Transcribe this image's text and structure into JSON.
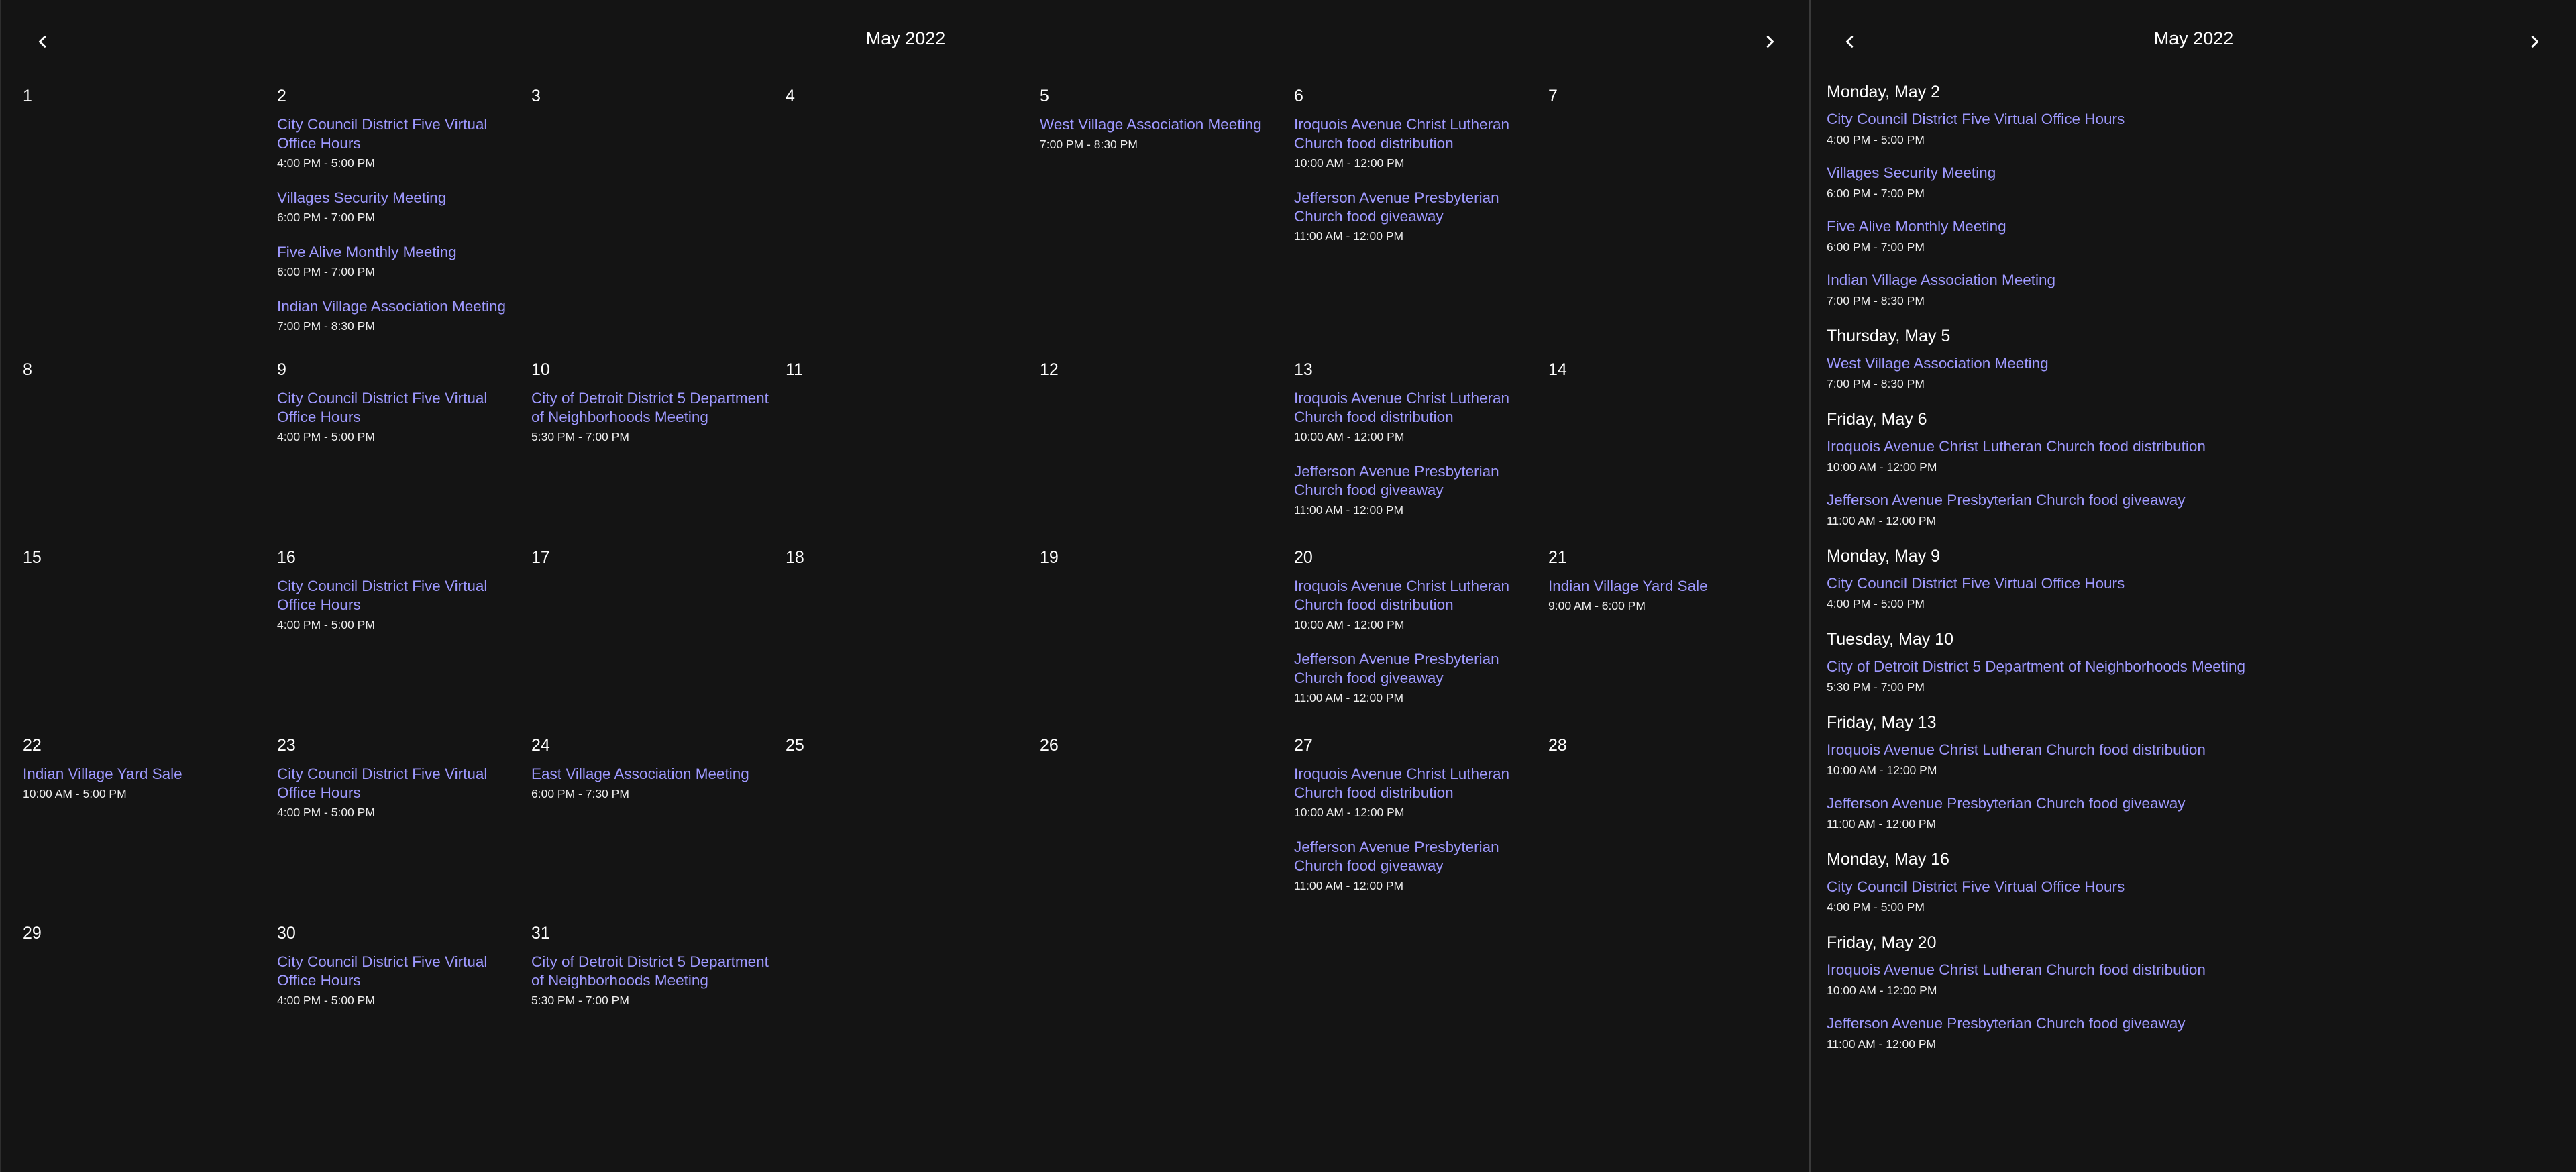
{
  "month_view": {
    "title": "May 2022",
    "prev_icon": "chevron-left-icon",
    "next_icon": "chevron-right-icon",
    "weeks": [
      [
        {
          "day": "1",
          "events": []
        },
        {
          "day": "2",
          "events": [
            {
              "title": "City Council District Five Virtual Office Hours",
              "time": "4:00 PM - 5:00 PM"
            },
            {
              "title": "Villages Security Meeting",
              "time": "6:00 PM - 7:00 PM"
            },
            {
              "title": "Five Alive Monthly Meeting",
              "time": "6:00 PM - 7:00 PM"
            },
            {
              "title": "Indian Village Association Meeting",
              "time": "7:00 PM - 8:30 PM"
            }
          ]
        },
        {
          "day": "3",
          "events": []
        },
        {
          "day": "4",
          "events": []
        },
        {
          "day": "5",
          "events": [
            {
              "title": "West Village Association Meeting",
              "time": "7:00 PM - 8:30 PM"
            }
          ]
        },
        {
          "day": "6",
          "events": [
            {
              "title": "Iroquois Avenue Christ Lutheran Church food distribution",
              "time": "10:00 AM - 12:00 PM"
            },
            {
              "title": "Jefferson Avenue Presbyterian Church food giveaway",
              "time": "11:00 AM - 12:00 PM"
            }
          ]
        },
        {
          "day": "7",
          "events": []
        }
      ],
      [
        {
          "day": "8",
          "events": []
        },
        {
          "day": "9",
          "events": [
            {
              "title": "City Council District Five Virtual Office Hours",
              "time": "4:00 PM - 5:00 PM"
            }
          ]
        },
        {
          "day": "10",
          "events": [
            {
              "title": "City of Detroit District 5 Department of Neighborhoods Meeting",
              "time": "5:30 PM - 7:00 PM"
            }
          ]
        },
        {
          "day": "11",
          "events": []
        },
        {
          "day": "12",
          "events": []
        },
        {
          "day": "13",
          "events": [
            {
              "title": "Iroquois Avenue Christ Lutheran Church food distribution",
              "time": "10:00 AM - 12:00 PM"
            },
            {
              "title": "Jefferson Avenue Presbyterian Church food giveaway",
              "time": "11:00 AM - 12:00 PM"
            }
          ]
        },
        {
          "day": "14",
          "events": []
        }
      ],
      [
        {
          "day": "15",
          "events": []
        },
        {
          "day": "16",
          "events": [
            {
              "title": "City Council District Five Virtual Office Hours",
              "time": "4:00 PM - 5:00 PM"
            }
          ]
        },
        {
          "day": "17",
          "events": []
        },
        {
          "day": "18",
          "events": []
        },
        {
          "day": "19",
          "events": []
        },
        {
          "day": "20",
          "events": [
            {
              "title": "Iroquois Avenue Christ Lutheran Church food distribution",
              "time": "10:00 AM - 12:00 PM"
            },
            {
              "title": "Jefferson Avenue Presbyterian Church food giveaway",
              "time": "11:00 AM - 12:00 PM"
            }
          ]
        },
        {
          "day": "21",
          "events": [
            {
              "title": "Indian Village Yard Sale",
              "time": "9:00 AM - 6:00 PM"
            }
          ]
        }
      ],
      [
        {
          "day": "22",
          "events": [
            {
              "title": "Indian Village Yard Sale",
              "time": "10:00 AM - 5:00 PM"
            }
          ]
        },
        {
          "day": "23",
          "events": [
            {
              "title": "City Council District Five Virtual Office Hours",
              "time": "4:00 PM - 5:00 PM"
            }
          ]
        },
        {
          "day": "24",
          "events": [
            {
              "title": "East Village Association Meeting",
              "time": "6:00 PM - 7:30 PM"
            }
          ]
        },
        {
          "day": "25",
          "events": []
        },
        {
          "day": "26",
          "events": []
        },
        {
          "day": "27",
          "events": [
            {
              "title": "Iroquois Avenue Christ Lutheran Church food distribution",
              "time": "10:00 AM - 12:00 PM"
            },
            {
              "title": "Jefferson Avenue Presbyterian Church food giveaway",
              "time": "11:00 AM - 12:00 PM"
            }
          ]
        },
        {
          "day": "28",
          "events": []
        }
      ],
      [
        {
          "day": "29",
          "events": []
        },
        {
          "day": "30",
          "events": [
            {
              "title": "City Council District Five Virtual Office Hours",
              "time": "4:00 PM - 5:00 PM"
            }
          ]
        },
        {
          "day": "31",
          "events": [
            {
              "title": "City of Detroit District 5 Department of Neighborhoods Meeting",
              "time": "5:30 PM - 7:00 PM"
            }
          ]
        },
        {
          "day": "",
          "events": []
        },
        {
          "day": "",
          "events": []
        },
        {
          "day": "",
          "events": []
        },
        {
          "day": "",
          "events": []
        }
      ]
    ]
  },
  "agenda_view": {
    "title": "May 2022",
    "prev_icon": "chevron-left-icon",
    "next_icon": "chevron-right-icon",
    "days": [
      {
        "header": "Monday, May 2",
        "events": [
          {
            "title": "City Council District Five Virtual Office Hours",
            "time": "4:00 PM - 5:00 PM"
          },
          {
            "title": "Villages Security Meeting",
            "time": "6:00 PM - 7:00 PM"
          },
          {
            "title": "Five Alive Monthly Meeting",
            "time": "6:00 PM - 7:00 PM"
          },
          {
            "title": "Indian Village Association Meeting",
            "time": "7:00 PM - 8:30 PM"
          }
        ]
      },
      {
        "header": "Thursday, May 5",
        "events": [
          {
            "title": "West Village Association Meeting",
            "time": "7:00 PM - 8:30 PM"
          }
        ]
      },
      {
        "header": "Friday, May 6",
        "events": [
          {
            "title": "Iroquois Avenue Christ Lutheran Church food distribution",
            "time": "10:00 AM - 12:00 PM"
          },
          {
            "title": "Jefferson Avenue Presbyterian Church food giveaway",
            "time": "11:00 AM - 12:00 PM"
          }
        ]
      },
      {
        "header": "Monday, May 9",
        "events": [
          {
            "title": "City Council District Five Virtual Office Hours",
            "time": "4:00 PM - 5:00 PM"
          }
        ]
      },
      {
        "header": "Tuesday, May 10",
        "events": [
          {
            "title": "City of Detroit District 5 Department of Neighborhoods Meeting",
            "time": "5:30 PM - 7:00 PM"
          }
        ]
      },
      {
        "header": "Friday, May 13",
        "events": [
          {
            "title": "Iroquois Avenue Christ Lutheran Church food distribution",
            "time": "10:00 AM - 12:00 PM"
          },
          {
            "title": "Jefferson Avenue Presbyterian Church food giveaway",
            "time": "11:00 AM - 12:00 PM"
          }
        ]
      },
      {
        "header": "Monday, May 16",
        "events": [
          {
            "title": "City Council District Five Virtual Office Hours",
            "time": "4:00 PM - 5:00 PM"
          }
        ]
      },
      {
        "header": "Friday, May 20",
        "events": [
          {
            "title": "Iroquois Avenue Christ Lutheran Church food distribution",
            "time": "10:00 AM - 12:00 PM"
          },
          {
            "title": "Jefferson Avenue Presbyterian Church food giveaway",
            "time": "11:00 AM - 12:00 PM"
          }
        ]
      }
    ]
  },
  "colors": {
    "background": "#141414",
    "event_link": "#9e99ff",
    "text": "#ffffff",
    "divider": "#3a3a3a"
  }
}
